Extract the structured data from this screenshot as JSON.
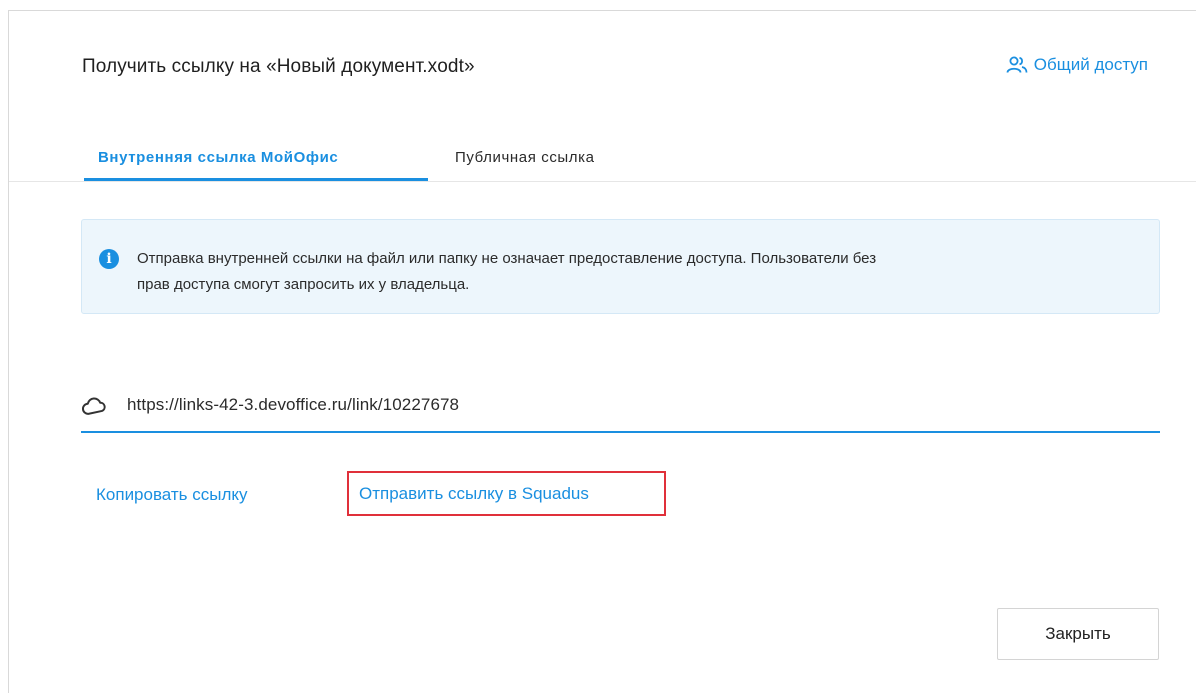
{
  "dialog": {
    "title": "Получить ссылку на «Новый документ.xodt»",
    "share_label": "Общий доступ",
    "share_icon": "users-icon"
  },
  "tabs": [
    {
      "label": "Внутренняя ссылка МойОфис",
      "active": true
    },
    {
      "label": "Публичная ссылка",
      "active": false
    }
  ],
  "info": {
    "icon": "info-icon",
    "line1": "Отправка внутренней ссылки на файл или папку не означает предоставление доступа. Пользователи без",
    "line2": "прав доступа смогут запросить их у владельца."
  },
  "link": {
    "icon": "cloud-icon",
    "url": "https://links-42-3.devoffice.ru/link/10227678"
  },
  "actions": {
    "copy_label": "Копировать ссылку",
    "send_label": "Отправить ссылку в Squadus"
  },
  "footer": {
    "close_label": "Закрыть"
  },
  "colors": {
    "accent": "#1a8fe0",
    "info_bg": "#edf6fc",
    "highlight_border": "#e0303a"
  }
}
